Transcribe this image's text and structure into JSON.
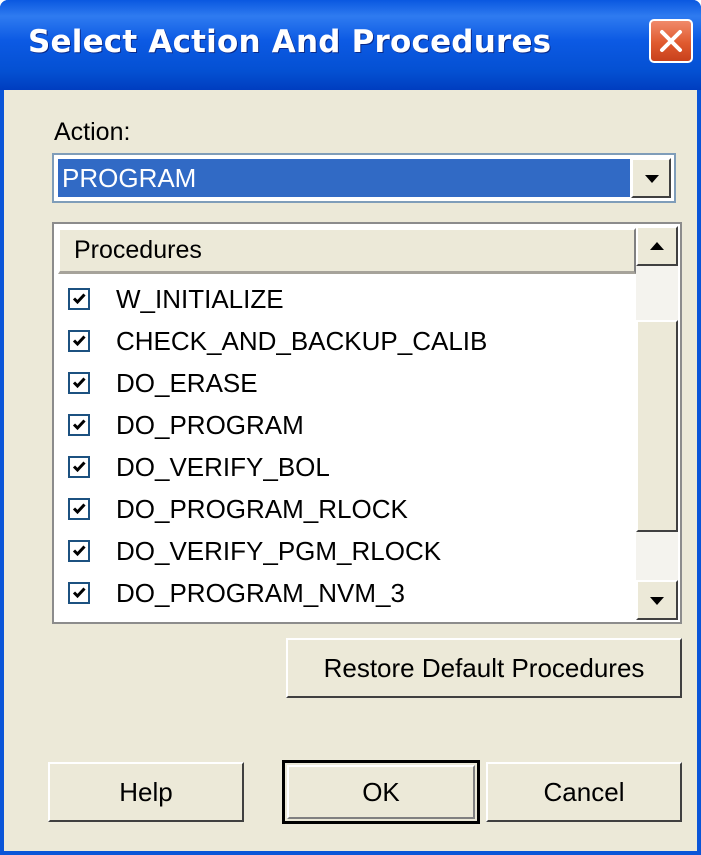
{
  "window": {
    "title": "Select Action And Procedures"
  },
  "action": {
    "label": "Action:",
    "selected": "PROGRAM"
  },
  "procedures": {
    "header": "Procedures",
    "items": [
      {
        "label": "W_INITIALIZE",
        "checked": true
      },
      {
        "label": "CHECK_AND_BACKUP_CALIB",
        "checked": true
      },
      {
        "label": "DO_ERASE",
        "checked": true
      },
      {
        "label": "DO_PROGRAM",
        "checked": true
      },
      {
        "label": "DO_VERIFY_BOL",
        "checked": true
      },
      {
        "label": "DO_PROGRAM_RLOCK",
        "checked": true
      },
      {
        "label": "DO_VERIFY_PGM_RLOCK",
        "checked": true
      },
      {
        "label": "DO_PROGRAM_NVM_3",
        "checked": true
      }
    ]
  },
  "buttons": {
    "restore": "Restore Default Procedures",
    "help": "Help",
    "ok": "OK",
    "cancel": "Cancel"
  },
  "colors": {
    "titlebar": "#0a58e0",
    "dialog_bg": "#ece9d8",
    "selection": "#316ac5",
    "close_button": "#e05a2f"
  }
}
